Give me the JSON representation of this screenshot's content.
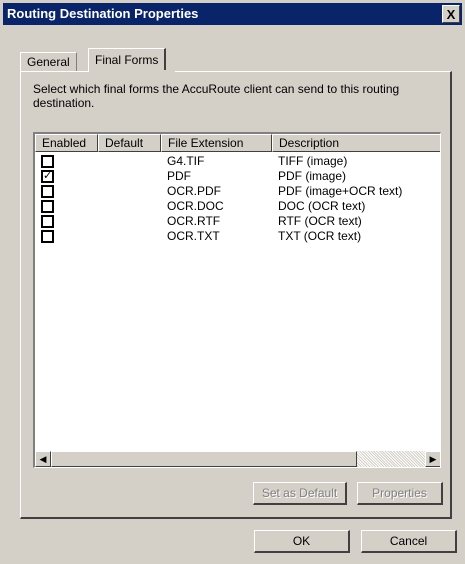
{
  "window": {
    "title": "Routing Destination Properties",
    "close_glyph": "X"
  },
  "tabs": [
    {
      "label": "General",
      "active": false
    },
    {
      "label": "Final Forms",
      "active": true
    }
  ],
  "instructions": "Select which final forms the AccuRoute client can send to this routing destination.",
  "columns": [
    "Enabled",
    "Default",
    "File Extension",
    "Description"
  ],
  "rows": [
    {
      "enabled": false,
      "default": "",
      "extension": "G4.TIF",
      "description": "TIFF (image)"
    },
    {
      "enabled": true,
      "default": "",
      "extension": "PDF",
      "description": "PDF (image)"
    },
    {
      "enabled": false,
      "default": "",
      "extension": "OCR.PDF",
      "description": "PDF (image+OCR text)"
    },
    {
      "enabled": false,
      "default": "",
      "extension": "OCR.DOC",
      "description": "DOC (OCR text)"
    },
    {
      "enabled": false,
      "default": "",
      "extension": "OCR.RTF",
      "description": "RTF (OCR text)"
    },
    {
      "enabled": false,
      "default": "",
      "extension": "OCR.TXT",
      "description": "TXT (OCR text)"
    }
  ],
  "check_glyph": "✓",
  "scrollbar": {
    "left_arrow": "◀",
    "right_arrow": "▶"
  },
  "buttons": {
    "set_default": "Set as Default",
    "properties": "Properties",
    "ok": "OK",
    "cancel": "Cancel"
  },
  "colors": {
    "titlebar": "#0a246a",
    "face": "#d4d0c8",
    "disabled_text": "#808080"
  }
}
